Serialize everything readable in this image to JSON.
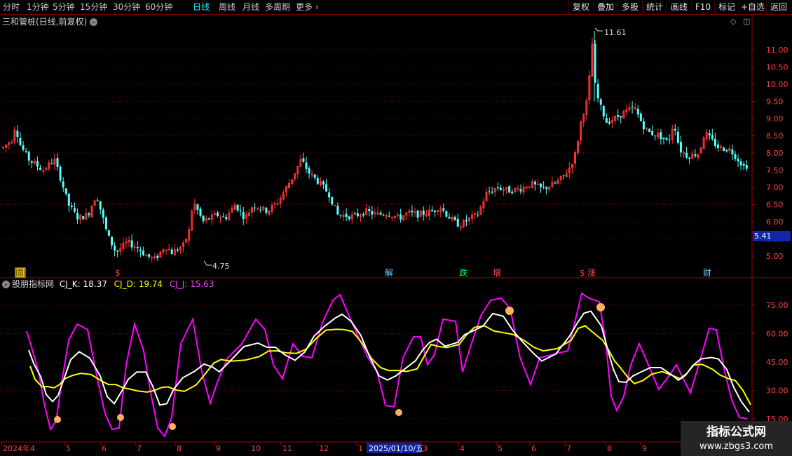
{
  "toolbar": {
    "periods": [
      "分时",
      "1分钟",
      "5分钟",
      "15分钟",
      "30分钟",
      "60分钟",
      "日线",
      "周线",
      "月线",
      "多周期",
      "更多"
    ],
    "active_period": "日线",
    "more_arrow": "›",
    "right_buttons": [
      "复权",
      "叠加",
      "多股",
      "统计",
      "画线",
      "F10",
      "标记",
      "+自选",
      "返回"
    ]
  },
  "main_chart": {
    "title": "三和管桩(日线,前复权)",
    "high_label": "11.61",
    "low_label": "4.75",
    "price_ticks": [
      "11.00",
      "10.50",
      "10.00",
      "9.50",
      "9.00",
      "8.50",
      "8.00",
      "7.50",
      "7.00",
      "6.50",
      "6.00",
      "5.50",
      "5.00"
    ],
    "current_price_tag": "5.41",
    "up_color": "#ff3232",
    "down_color": "#54ffff",
    "event_markers": [
      {
        "label": "回",
        "color": "#ffd000"
      },
      {
        "label": "$",
        "color": "#ff3030"
      },
      {
        "label": "解",
        "color": "#6ad0ff"
      },
      {
        "label": "跌",
        "color": "#00ff60"
      },
      {
        "label": "增",
        "color": "#ff5050"
      },
      {
        "label": "$",
        "color": "#ff3030"
      },
      {
        "label": "涨",
        "color": "#ff5050"
      },
      {
        "label": "财",
        "color": "#6ad0ff"
      }
    ]
  },
  "indicator": {
    "name": "股朋指标网",
    "k_label": "CJ_K: 18.37",
    "d_label": "CJ_D: 19.74",
    "j_label": "CJ_J: 15.63",
    "k_color": "#ffffff",
    "d_color": "#ffff00",
    "j_color": "#ff00ff",
    "ticks": [
      "75.00",
      "60.00",
      "45.00",
      "30.00",
      "15.00"
    ]
  },
  "time_axis": {
    "labels": [
      "2024年4",
      "5",
      "6",
      "7",
      "8",
      "9",
      "10",
      "11",
      "12",
      "1",
      "2025/01/10/五",
      "3",
      "4",
      "5",
      "6",
      "7",
      "8",
      "9"
    ]
  },
  "watermark": {
    "line1": "指标公式网",
    "line2": "www.zbgs3.com"
  }
}
